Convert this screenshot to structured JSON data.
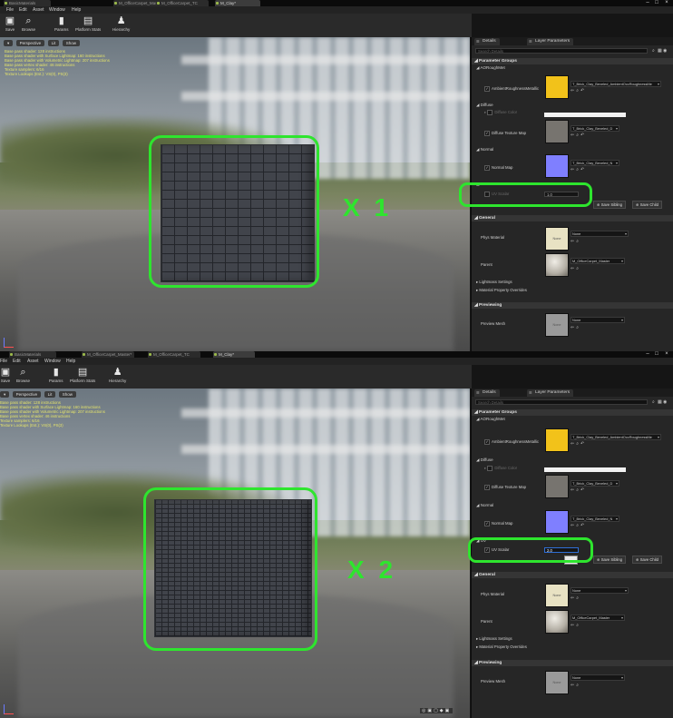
{
  "tabs": [
    "BasicMaterials",
    "M_OfficeCarpet_Master*",
    "M_OfficeCarpet_TC",
    "M_Clay*"
  ],
  "menu": [
    "File",
    "Edit",
    "Asset",
    "Window",
    "Help"
  ],
  "toolbar": [
    "Save",
    "Browse",
    "Params",
    "Platform Stats",
    "Hierarchy"
  ],
  "viewport": {
    "perspective": "Perspective",
    "lit": "Lit",
    "show": "Show",
    "stats": [
      "Base pass shader: 128 instructions",
      "Base pass shader with Surface Lightmap: 160 instructions",
      "Base pass shader with Volumetric Lightmap: 207 instructions",
      "Base pass vertex shader: 46 instructions",
      "Texture samplers: 6/16",
      "Texture Lookups (Est.): VS(0), PS(3)"
    ]
  },
  "top": {
    "multiplier": "X 1",
    "uv_value": "1.0"
  },
  "bottom": {
    "multiplier": "X 2",
    "uv_value": "2.0"
  },
  "panel": {
    "details_tab": "Details",
    "layer_tab": "Layer Parameters",
    "search_placeholder": "Search Details",
    "parameter_groups": "Parameter Groups",
    "group_aorm": "AORoughMet",
    "ambient_label": "AmbientRoughnessMetallic",
    "ambient_texture": "T_Brick_Clay_Beveled_AmbientOccRoughnessMe",
    "group_diffuse": "Diffuse",
    "diffuse_color": "Diffuse Color",
    "diffuse_map": "Diffuse Texture Map",
    "diffuse_texture": "T_Brick_Clay_Beveled_D",
    "group_normal": "Normal",
    "normal_map": "Normal Map",
    "normal_texture": "T_Brick_Clay_Beveled_N",
    "group_uv": "UV",
    "uv_scalar": "UV Scalar",
    "save_sibling": "Save Sibling",
    "save_child": "Save Child",
    "general": "General",
    "phys_material": "Phys Material",
    "phys_value": "None",
    "parent": "Parent",
    "parent_value": "M_OfficeCarpet_Master",
    "lightmass": "Lightmass Settings",
    "overrides": "Material Property Overrides",
    "previewing": "Previewing",
    "preview_mesh": "Preview Mesh",
    "preview_value": "None",
    "none_thumb": "None"
  },
  "colors": {
    "highlight": "#2ee52e",
    "ao_yellow": "#f2c21a",
    "normal_blue": "#7f7fff",
    "stats_yellow": "#e4e36b"
  }
}
